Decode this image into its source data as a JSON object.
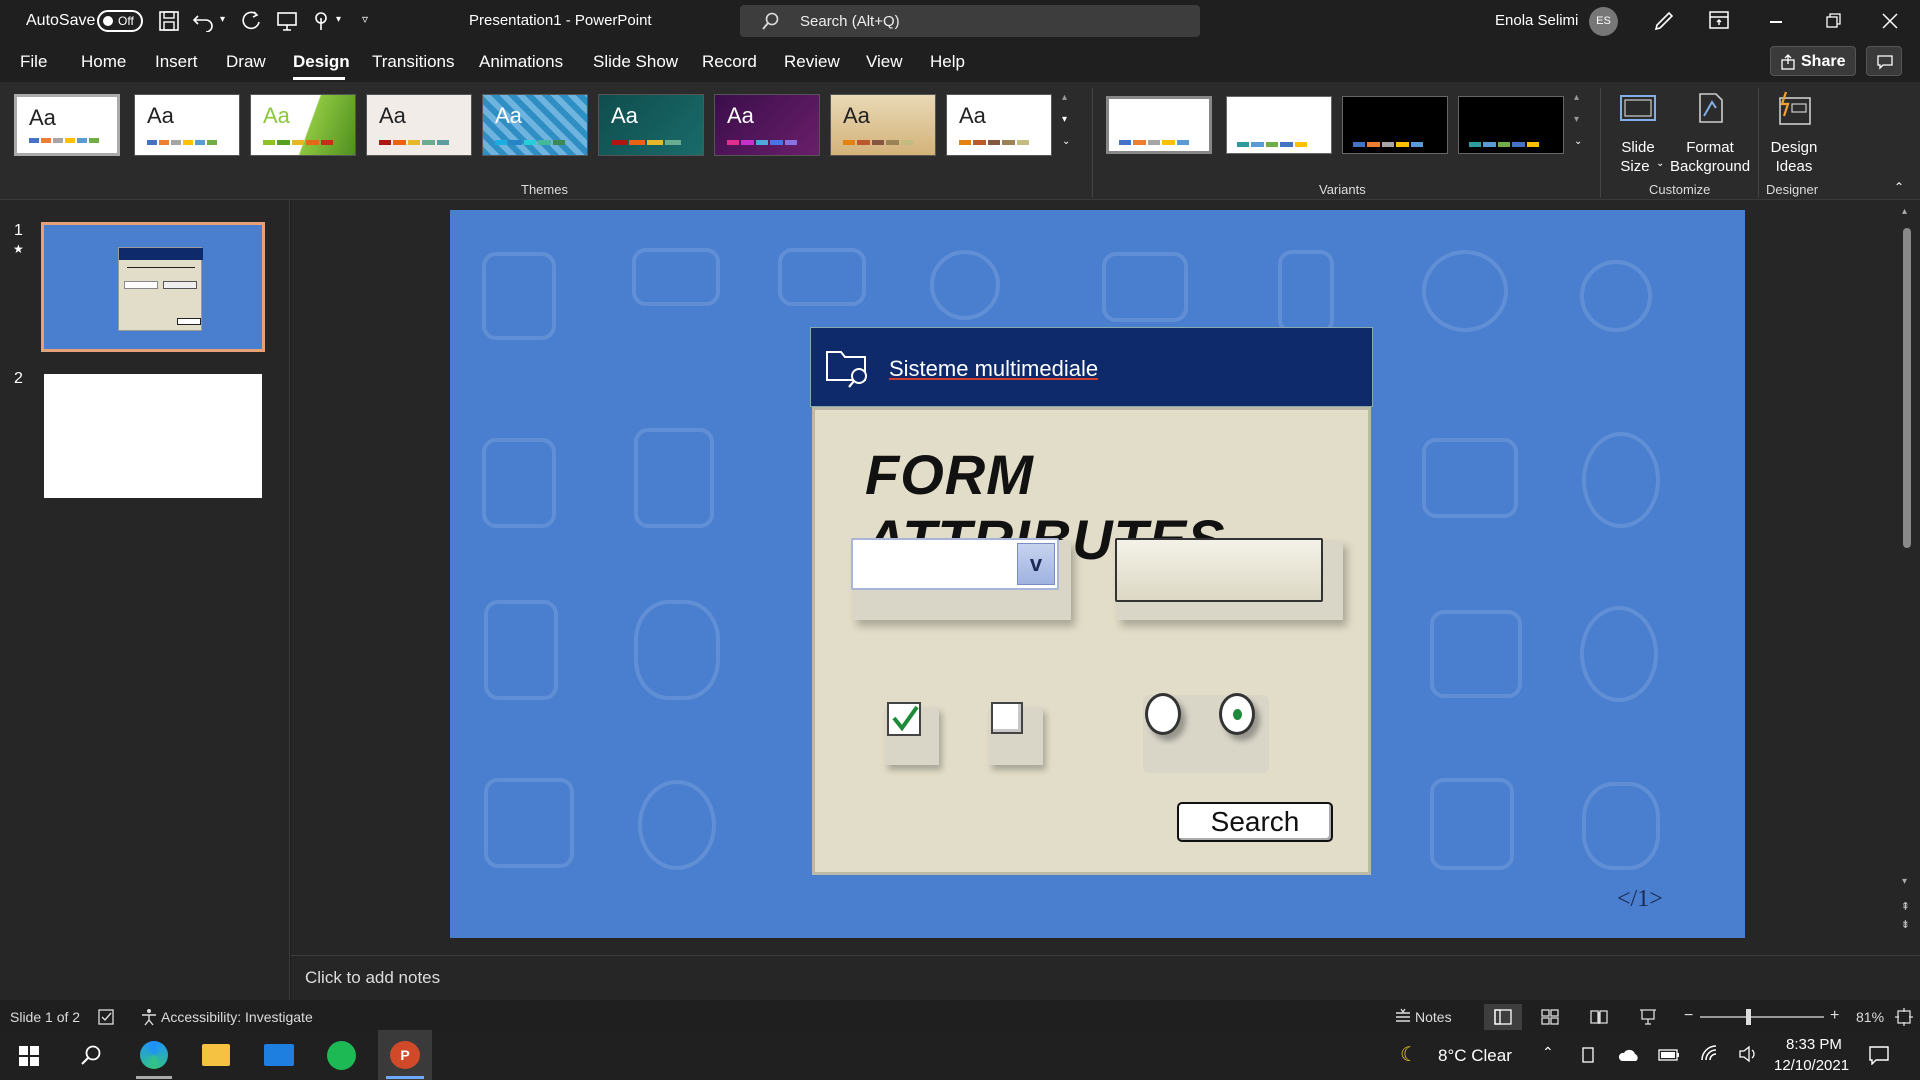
{
  "titlebar": {
    "autosave_label": "AutoSave",
    "autosave_state": "Off",
    "doc_title": "Presentation1  -  PowerPoint",
    "search_placeholder": "Search (Alt+Q)",
    "user_name": "Enola Selimi",
    "user_initials": "ES"
  },
  "menu": {
    "items": [
      "File",
      "Home",
      "Insert",
      "Draw",
      "Design",
      "Transitions",
      "Animations",
      "Slide Show",
      "Record",
      "Review",
      "View",
      "Help"
    ],
    "active": "Design",
    "share_label": "Share"
  },
  "ribbon": {
    "themes_label": "Themes",
    "variants_label": "Variants",
    "customize_label": "Customize",
    "designer_label": "Designer",
    "theme_text": "Aa",
    "slide_size_line1": "Slide",
    "slide_size_line2": "Size",
    "format_bg_line1": "Format",
    "format_bg_line2": "Background",
    "design_ideas_line1": "Design",
    "design_ideas_line2": "Ideas"
  },
  "thumbnails": {
    "slide1_number": "1",
    "slide1_star": "★",
    "slide2_number": "2"
  },
  "slide": {
    "header_title": "Sisteme multimediale",
    "heading": "FORM ATTRIBUTES",
    "dropdown_arrow": "v",
    "search_button": "Search",
    "page_marker": "</1>",
    "checkbox1_checked": true,
    "checkbox2_checked": false,
    "radio1_selected": false,
    "radio2_selected": true
  },
  "notes": {
    "placeholder": "Click to add notes"
  },
  "statusbar": {
    "slide_counter": "Slide 1 of 2",
    "accessibility": "Accessibility: Investigate",
    "notes_label": "Notes",
    "zoom": "81%"
  },
  "taskbar": {
    "weather": "8°C  Clear",
    "time": "8:33 PM",
    "date": "12/10/2021"
  },
  "colors": {
    "slide_bg": "#4a7fcf",
    "dialog_header": "#0e2a6b",
    "dialog_body": "#e2ddc8",
    "accent_underline": "#c43e1c"
  }
}
